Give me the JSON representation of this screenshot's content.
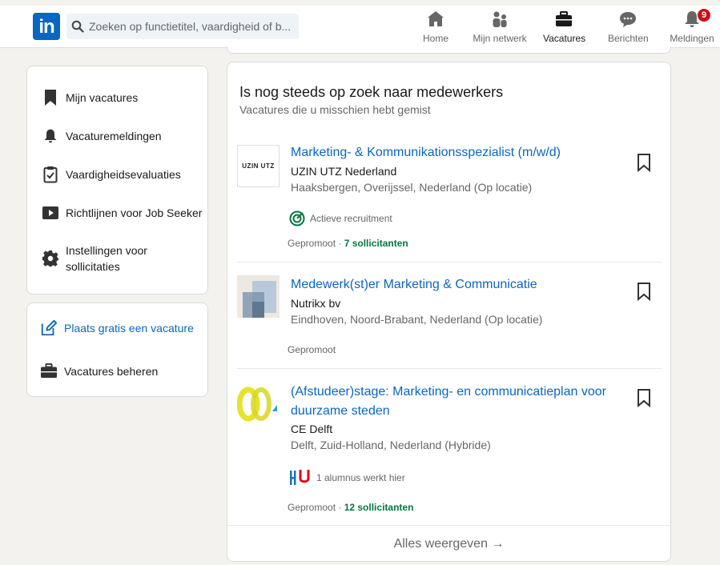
{
  "nav": {
    "logo_text": "in",
    "search_placeholder": "Zoeken op functietitel, vaardigheid of b...",
    "items": [
      {
        "label": "Home",
        "icon": "home-icon"
      },
      {
        "label": "Mijn netwerk",
        "icon": "network-icon"
      },
      {
        "label": "Vacatures",
        "icon": "briefcase-icon",
        "active": true
      },
      {
        "label": "Berichten",
        "icon": "messaging-icon"
      },
      {
        "label": "Meldingen",
        "icon": "bell-icon",
        "badge": "9"
      }
    ]
  },
  "sidebar": {
    "items": [
      {
        "label": "Mijn vacatures",
        "icon": "bookmark-icon"
      },
      {
        "label": "Vacaturemeldingen",
        "icon": "bell-icon"
      },
      {
        "label": "Vaardigheidsevaluaties",
        "icon": "clipboard-check-icon"
      },
      {
        "label": "Richtlijnen voor Job Seeker",
        "icon": "video-play-icon"
      },
      {
        "label": "Instellingen voor sollicitaties",
        "icon": "gear-icon"
      }
    ],
    "actions": [
      {
        "label": "Plaats gratis een vacature",
        "icon": "edit-icon"
      },
      {
        "label": "Vacatures beheren",
        "icon": "briefcase-icon"
      }
    ]
  },
  "main": {
    "title": "Is nog steeds op zoek naar medewerkers",
    "subtitle": "Vacatures die u misschien hebt gemist",
    "jobs": [
      {
        "title": "Marketing- & Kommunikationsspezialist (m/w/d)",
        "company": "UZIN UTZ Nederland",
        "location": "Haaksbergen, Overijssel, Nederland (Op locatie)",
        "logo_text": "UZIN UTZ",
        "insight": "Actieve recruitment",
        "promoted": "Gepromoot",
        "applicants": "7 sollicitanten"
      },
      {
        "title": "Medewerk(st)er Marketing & Communicatie",
        "company": "Nutrikx bv",
        "location": "Eindhoven, Noord-Brabant, Nederland (Op locatie)",
        "promoted": "Gepromoot"
      },
      {
        "title": "(Afstudeer)stage: Marketing- en communicatieplan voor duurzame steden",
        "company": "CE Delft",
        "location": "Delft, Zuid-Holland, Nederland (Hybride)",
        "insight": "1 alumnus werkt hier",
        "promoted": "Gepromoot",
        "applicants": "12 sollicitanten"
      }
    ],
    "show_all": "Alles weergeven →"
  },
  "colors": {
    "brand": "#0a66c2",
    "green": "#057642",
    "badge": "#cc1016"
  }
}
